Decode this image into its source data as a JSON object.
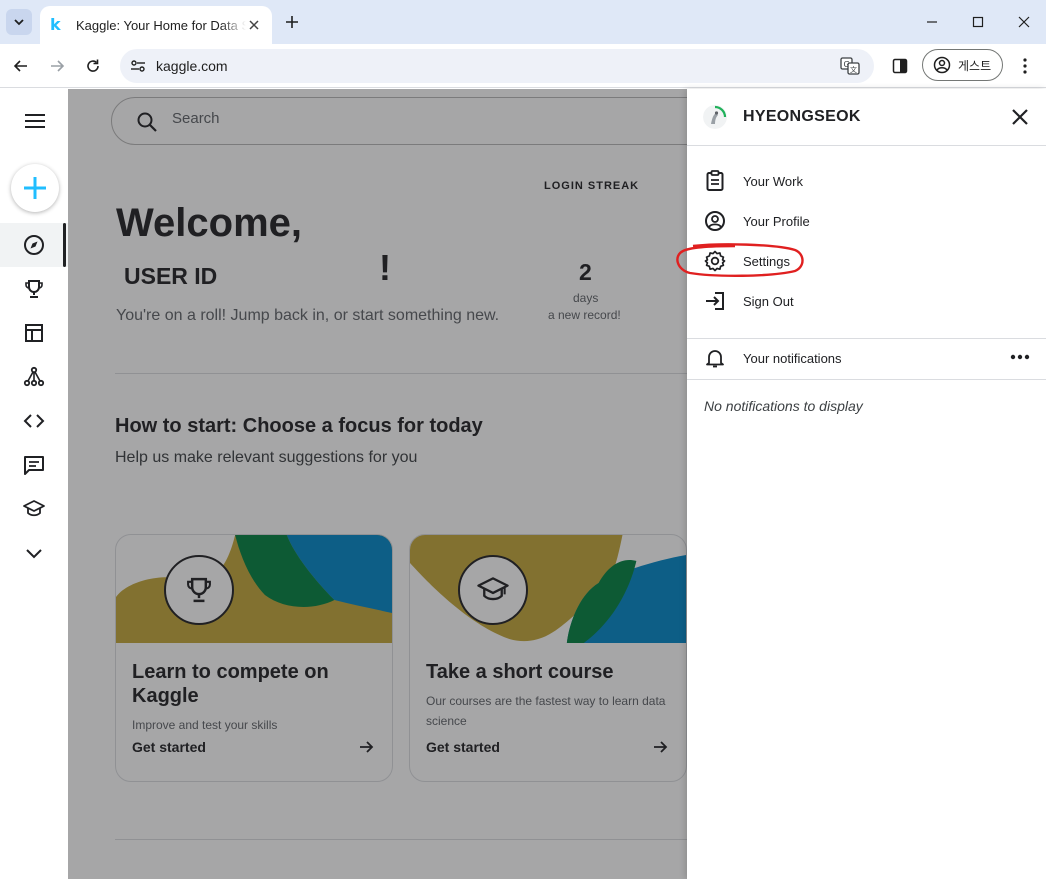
{
  "browser": {
    "tab_title": "Kaggle: Your Home for Data Science",
    "tab_favicon": "k",
    "url": "kaggle.com",
    "profile_label": "게스트"
  },
  "search": {
    "placeholder": "Search"
  },
  "home": {
    "login_streak_label": "LOGIN STREAK",
    "welcome": "Welcome,",
    "user_id": "USER ID",
    "exclaim": "!",
    "streak_number": "2",
    "streak_unit": "days",
    "streak_note": "a new record!",
    "roll_text": "You're on a roll! Jump back in, or start something new.",
    "howto_title": "How to start: Choose a focus for today",
    "howto_sub": "Help us make relevant suggestions for you"
  },
  "cards": [
    {
      "title": "Learn to compete on Kaggle",
      "desc": "Improve and test your skills",
      "cta": "Get started",
      "icon": "trophy-icon"
    },
    {
      "title": "Take a short course",
      "desc": "Our courses are the fastest way to learn data science",
      "cta": "Get started",
      "icon": "graduation-cap-icon"
    }
  ],
  "leftnav": {
    "items": [
      "compass-icon",
      "trophy-icon",
      "table-icon",
      "models-icon",
      "code-icon",
      "discussion-icon",
      "learn-icon",
      "chevron-down-icon"
    ]
  },
  "panel": {
    "username": "HYEONGSEOK",
    "menu": [
      {
        "label": "Your Work",
        "icon": "clipboard-icon"
      },
      {
        "label": "Your Profile",
        "icon": "profile-icon"
      },
      {
        "label": "Settings",
        "icon": "gear-icon"
      },
      {
        "label": "Sign Out",
        "icon": "sign-out-icon"
      }
    ],
    "notifications_label": "Your notifications",
    "no_notifications": "No notifications to display"
  },
  "colors": {
    "kaggle_blue": "#20beff",
    "art_yellow": "#c4a73a",
    "art_green": "#008040",
    "art_blue": "#0088c8",
    "annotation_red": "#e02020"
  }
}
